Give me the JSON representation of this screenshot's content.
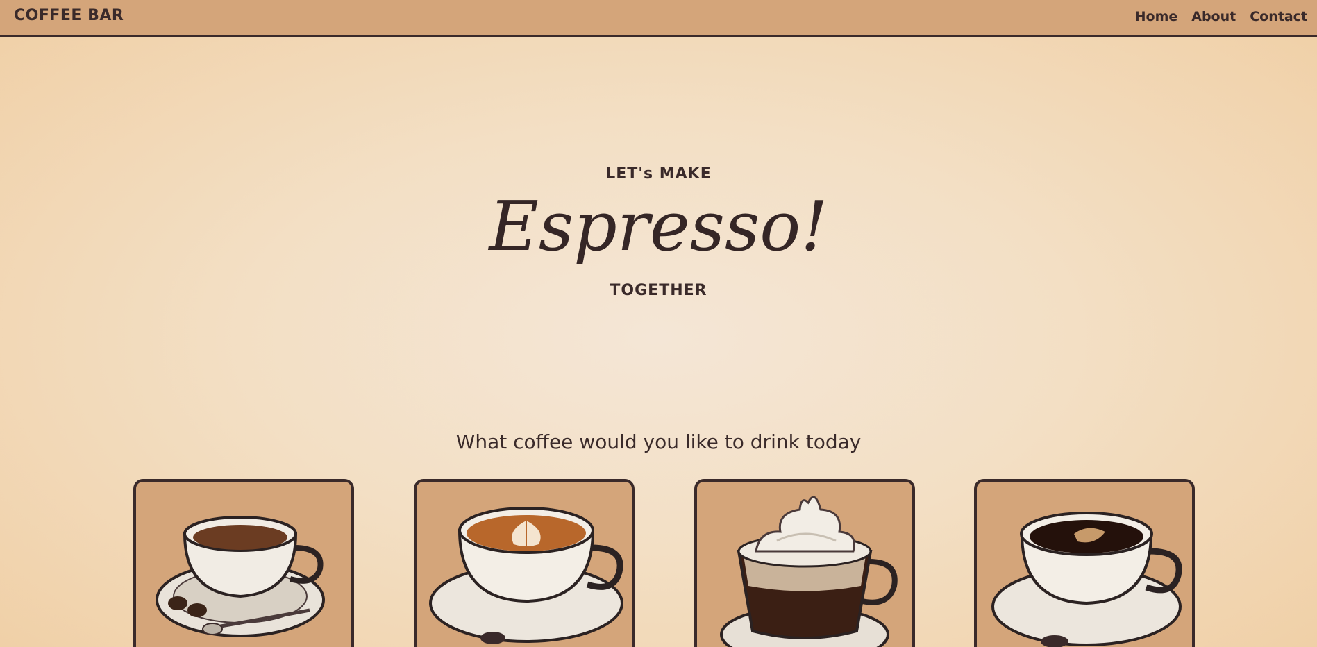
{
  "header": {
    "brand": "COFFEE BAR",
    "nav": [
      "Home",
      "About",
      "Contact"
    ]
  },
  "hero": {
    "pre": "LET's MAKE",
    "title": "Espresso!",
    "post": "TOGETHER"
  },
  "menu": {
    "title": "What coffee would you like to drink today",
    "items": [
      {
        "name": "espresso-cup-image"
      },
      {
        "name": "latte-cup-image"
      },
      {
        "name": "whipped-cream-coffee-image"
      },
      {
        "name": "black-coffee-cup-image"
      }
    ]
  },
  "colors": {
    "accent": "#d4a57a",
    "text": "#3a2a2a"
  }
}
